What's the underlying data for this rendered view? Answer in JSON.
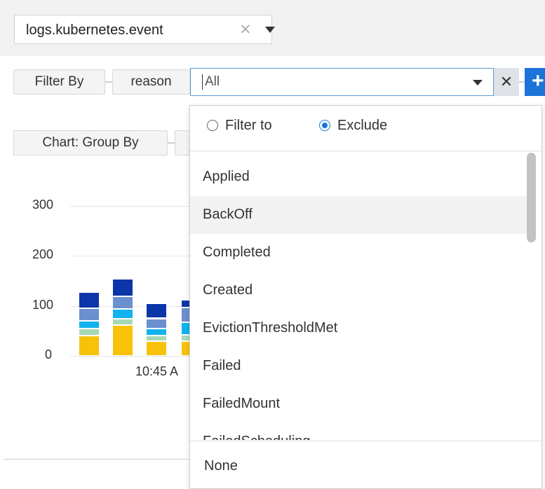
{
  "source_selector": {
    "value": "logs.kubernetes.event",
    "clear_icon": "close-icon",
    "caret_icon": "caret-down-icon"
  },
  "filter_row": {
    "filter_by_label": "Filter By",
    "field_label": "reason",
    "input_value": "All",
    "remove_icon": "close-icon",
    "add_icon": "plus-icon"
  },
  "chart_group_by_label": "Chart: Group By",
  "dropdown": {
    "filter_to_label": "Filter to",
    "exclude_label": "Exclude",
    "selected_mode": "Exclude",
    "options": [
      "Applied",
      "BackOff",
      "Completed",
      "Created",
      "EvictionThresholdMet",
      "Failed",
      "FailedMount",
      "FailedScheduling"
    ],
    "hovered_option": "BackOff",
    "footer_label": "None"
  },
  "chart_data": {
    "type": "bar",
    "stacked": true,
    "y_ticks": [
      "300",
      "200",
      "100",
      "0"
    ],
    "ylim": [
      0,
      300
    ],
    "x_tick_labels": [
      "10:45 A"
    ],
    "colors": [
      "#f9c20a",
      "#a6d9b3",
      "#10b3f0",
      "#6b8fcf",
      "#0b35a8"
    ],
    "bars": [
      {
        "segments": [
          40,
          15,
          15,
          25,
          33
        ]
      },
      {
        "segments": [
          62,
          12,
          20,
          25,
          35
        ]
      },
      {
        "segments": [
          30,
          10,
          15,
          20,
          30
        ]
      },
      {
        "segments": [
          30,
          12,
          25,
          30,
          15
        ]
      }
    ]
  }
}
